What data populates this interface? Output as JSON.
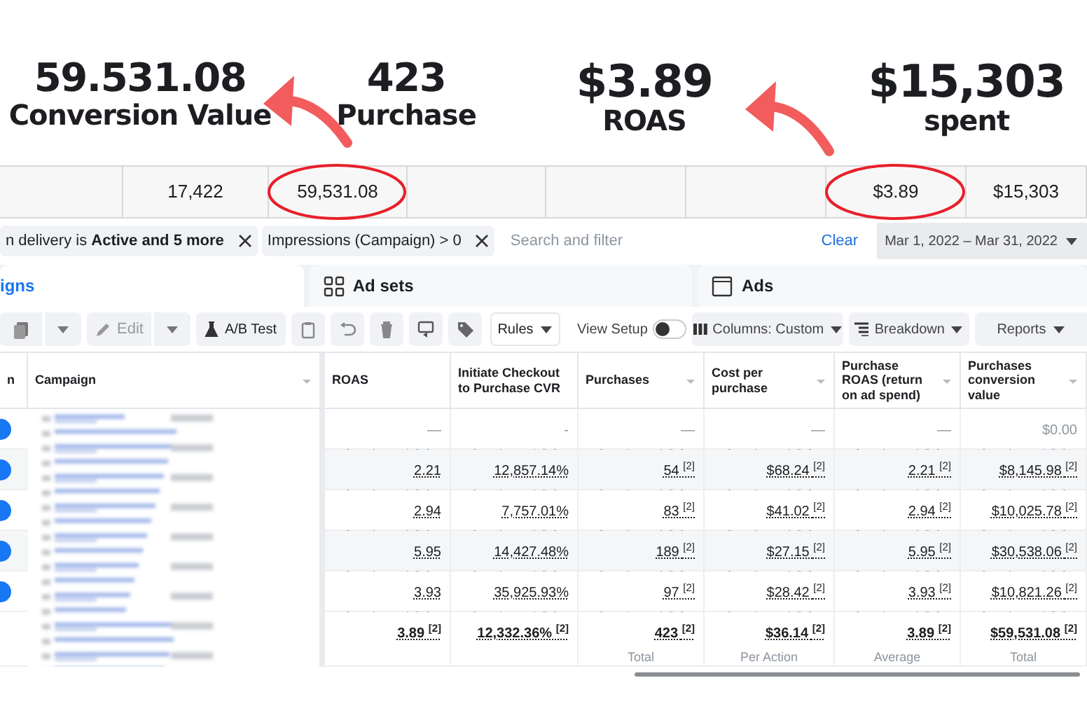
{
  "annotations": [
    {
      "value": "59.531.08",
      "label": "Conversion Value"
    },
    {
      "value": "423",
      "label": "Purchase"
    },
    {
      "value": "$3.89",
      "label": "ROAS"
    },
    {
      "value": "$15,303",
      "label": "spent"
    }
  ],
  "summary_row": [
    {
      "kind": "blank"
    },
    {
      "kind": "value",
      "text": "17,422"
    },
    {
      "kind": "value",
      "text": "59,531.08",
      "circled": true
    },
    {
      "kind": "blank"
    },
    {
      "kind": "blank"
    },
    {
      "kind": "blank"
    },
    {
      "kind": "value",
      "text": "$3.89",
      "circled": true
    },
    {
      "kind": "value",
      "text": "$15,303"
    }
  ],
  "filters": [
    {
      "text": "n delivery is **Active and 5 more**"
    },
    {
      "text": "Impressions (Campaign) > 0"
    }
  ],
  "search": {
    "placeholder": "Search and filter"
  },
  "clear": "Clear",
  "date_range": "Mar 1, 2022 – Mar 31, 2022",
  "tabs": [
    {
      "label": "igns",
      "selected": true
    },
    {
      "label": "Ad sets",
      "selected": false
    },
    {
      "label": "Ads",
      "selected": false
    }
  ],
  "toolbar": {
    "edit": "Edit",
    "ab_test": "A/B Test",
    "rules": "Rules",
    "view_setup": "View Setup",
    "view_setup_on": false,
    "columns": "Columns: Custom",
    "breakdown": "Breakdown",
    "reports": "Reports"
  },
  "table": {
    "columns": [
      "n",
      "Campaign",
      "ROAS",
      "Initiate Checkout to Purchase CVR",
      "Purchases",
      "Cost per purchase",
      "Purchase ROAS (return on ad spend)",
      "Purchases conversion value"
    ],
    "rows": [
      {
        "kind": "empty",
        "on": true,
        "cells": [
          "",
          "",
          "—",
          "-",
          "—",
          "—",
          "—",
          "$0.00"
        ]
      },
      {
        "kind": "data",
        "on": true,
        "cells": [
          "",
          "",
          "2.21",
          "12,857.14%",
          "54 $^{[2]}$",
          "$68.24 $^{[2]}$",
          "2.21 $^{[2]}$",
          "$8,145.98 $^{[2]}$"
        ]
      },
      {
        "kind": "data",
        "on": true,
        "cells": [
          "",
          "",
          "2.94",
          "7,757.01%",
          "83 $^{[2]}$",
          "$41.02 $^{[2]}$",
          "2.94 $^{[2]}$",
          "$10,025.78 $^{[2]}$"
        ]
      },
      {
        "kind": "data",
        "on": true,
        "cells": [
          "",
          "",
          "5.95",
          "14,427.48%",
          "189 $^{[2]}$",
          "$27.15 $^{[2]}$",
          "5.95 $^{[2]}$",
          "$30,538.06 $^{[2]}$"
        ]
      },
      {
        "kind": "data",
        "on": true,
        "cells": [
          "",
          "",
          "3.93",
          "35,925.93%",
          "97 $^{[2]}$",
          "$28.42 $^{[2]}$",
          "3.93 $^{[2]}$",
          "$10,821.26 $^{[2]}$"
        ]
      },
      {
        "kind": "total",
        "cells": [
          "",
          "",
          {
            "text": "3.89 $^{[2]}$"
          },
          {
            "text": "12,332.36% $^{[2]}$"
          },
          {
            "text": "423 $^{[2]}$",
            "sub": "Total"
          },
          {
            "text": "$36.14 $^{[2]}$",
            "sub": "Per Action"
          },
          {
            "text": "3.89 $^{[2]}$",
            "sub": "Average"
          },
          {
            "text": "$59,531.08 $^{[2]}$",
            "sub": "Total"
          }
        ]
      }
    ]
  }
}
